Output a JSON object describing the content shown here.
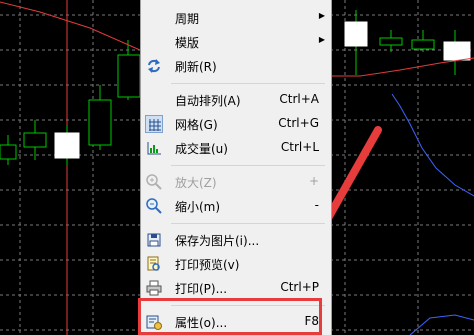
{
  "menu": {
    "items": [
      {
        "label": "周期",
        "shortcut": "",
        "submenu": true,
        "icon": "none",
        "disabled": false
      },
      {
        "label": "模版",
        "shortcut": "",
        "submenu": true,
        "icon": "none",
        "disabled": false
      },
      {
        "label": "刷新(R)",
        "shortcut": "",
        "submenu": false,
        "icon": "refresh-icon",
        "disabled": false
      },
      {
        "label": "自动排列(A)",
        "shortcut": "Ctrl+A",
        "submenu": false,
        "icon": "none",
        "disabled": false
      },
      {
        "label": "网格(G)",
        "shortcut": "Ctrl+G",
        "submenu": false,
        "icon": "grid-icon",
        "disabled": false,
        "checked": true
      },
      {
        "label": "成交量(u)",
        "shortcut": "Ctrl+L",
        "submenu": false,
        "icon": "volume-icon",
        "disabled": false
      },
      {
        "label": "放大(Z)",
        "shortcut": "+",
        "submenu": false,
        "icon": "zoom-in-icon",
        "disabled": true
      },
      {
        "label": "缩小(m)",
        "shortcut": "-",
        "submenu": false,
        "icon": "zoom-out-icon",
        "disabled": false
      },
      {
        "label": "保存为图片(i)...",
        "shortcut": "",
        "submenu": false,
        "icon": "save-image-icon",
        "disabled": false
      },
      {
        "label": "打印预览(v)",
        "shortcut": "",
        "submenu": false,
        "icon": "print-preview-icon",
        "disabled": false
      },
      {
        "label": "打印(P)...",
        "shortcut": "Ctrl+P",
        "submenu": false,
        "icon": "print-icon",
        "disabled": false
      },
      {
        "label": "属性(o)...",
        "shortcut": "F8",
        "submenu": false,
        "icon": "properties-icon",
        "disabled": false
      }
    ]
  },
  "colors": {
    "background": "#000000",
    "grid": "#7a7a7a",
    "candle": "#00c800",
    "vertical_line": "#e23b3b",
    "moving_average": "#e23b3b",
    "annotation": "#e63c3c",
    "indicator": "#3c64ff"
  }
}
